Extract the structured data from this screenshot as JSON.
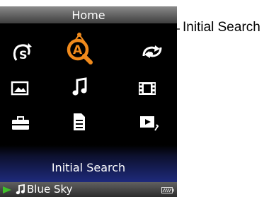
{
  "screen": {
    "title": "Home",
    "menu_icons": [
      "podcast-icon",
      "initial-search-icon",
      "shuffle-icon",
      "photo-icon",
      "music-icon",
      "video-icon",
      "settings-icon",
      "playlist-icon",
      "now-playing-icon"
    ],
    "selected_index": 1,
    "selected_caption": "Initial Search",
    "now_playing": {
      "track": "Blue Sky"
    },
    "colors": {
      "selected": "#f08a1c",
      "icon": "#ffffff",
      "status_play": "#3fbf2a"
    }
  },
  "callout": {
    "label": "Initial Search"
  }
}
